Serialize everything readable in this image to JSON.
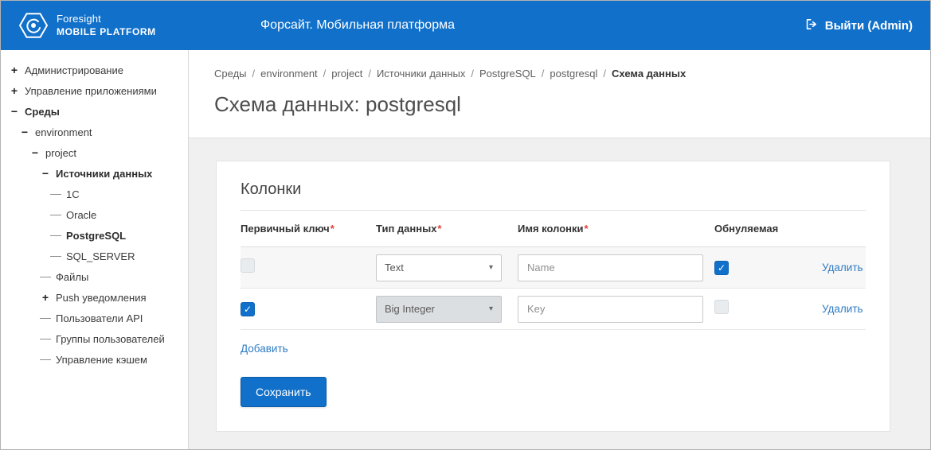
{
  "colors": {
    "accent": "#1070ca",
    "link": "#2f7cc3",
    "required": "#e04238"
  },
  "icons": {
    "plus": "+",
    "minus": "−",
    "dropdown_arrow": "▾",
    "check": "✓"
  },
  "header": {
    "brand_line1": "Foresight",
    "brand_line2": "MOBILE PLATFORM",
    "title": "Форсайт. Мобильная платформа",
    "logout": "Выйти (Admin)"
  },
  "sidebar": {
    "items": [
      {
        "label": "Администрирование",
        "icon": "plus",
        "level": 0,
        "bold": false
      },
      {
        "label": "Управление приложениями",
        "icon": "plus",
        "level": 0,
        "bold": false
      },
      {
        "label": "Среды",
        "icon": "minus",
        "level": 0,
        "bold": true
      },
      {
        "label": "environment",
        "icon": "minus",
        "level": 1,
        "bold": false
      },
      {
        "label": "project",
        "icon": "minus",
        "level": 2,
        "bold": false
      },
      {
        "label": "Источники данных",
        "icon": "minus",
        "level": 3,
        "bold": true
      },
      {
        "label": "1C",
        "icon": "dash",
        "level": 4,
        "bold": false
      },
      {
        "label": "Oracle",
        "icon": "dash",
        "level": 4,
        "bold": false
      },
      {
        "label": "PostgreSQL",
        "icon": "dash",
        "level": 4,
        "bold": true
      },
      {
        "label": "SQL_SERVER",
        "icon": "dash",
        "level": 4,
        "bold": false
      },
      {
        "label": "Файлы",
        "icon": "dash",
        "level": 3,
        "bold": false
      },
      {
        "label": "Push уведомления",
        "icon": "plus",
        "level": 3,
        "bold": false
      },
      {
        "label": "Пользователи API",
        "icon": "dash",
        "level": 3,
        "bold": false
      },
      {
        "label": "Группы пользователей",
        "icon": "dash",
        "level": 3,
        "bold": false
      },
      {
        "label": "Управление кэшем",
        "icon": "dash",
        "level": 3,
        "bold": false
      }
    ]
  },
  "breadcrumb": {
    "separator": "/",
    "items": [
      "Среды",
      "environment",
      "project",
      "Источники данных",
      "PostgreSQL",
      "postgresql",
      "Схема данных"
    ]
  },
  "page_title": "Схема данных: postgresql",
  "card": {
    "title": "Колонки",
    "headers": [
      {
        "label": "Первичный ключ",
        "required": "*"
      },
      {
        "label": "Тип данных",
        "required": "*"
      },
      {
        "label": "Имя колонки",
        "required": "*"
      },
      {
        "label": "Обнуляемая",
        "required": ""
      }
    ],
    "rows": [
      {
        "primary_key_checked": false,
        "primary_key_disabled": true,
        "type_value": "Text",
        "type_disabled": false,
        "name_value": "Name",
        "nullable_checked": true,
        "nullable_disabled": false,
        "delete_label": "Удалить"
      },
      {
        "primary_key_checked": true,
        "primary_key_disabled": false,
        "type_value": "Big Integer",
        "type_disabled": true,
        "name_value": "Key",
        "nullable_checked": false,
        "nullable_disabled": true,
        "delete_label": "Удалить"
      }
    ],
    "add_label": "Добавить",
    "save_label": "Сохранить"
  }
}
